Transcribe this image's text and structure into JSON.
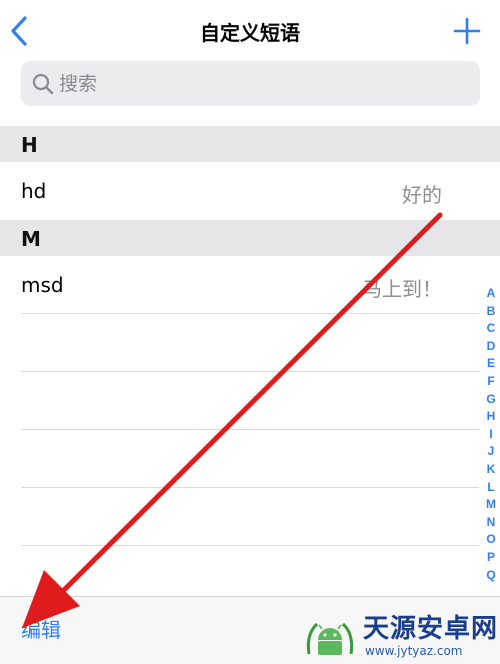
{
  "nav": {
    "title": "自定义短语",
    "back_icon": "chevron-left-icon",
    "add_icon": "plus-icon"
  },
  "search": {
    "placeholder": "搜索",
    "value": ""
  },
  "sections": [
    {
      "header": "H",
      "items": [
        {
          "shortcut": "hd",
          "phrase": "好的"
        }
      ]
    },
    {
      "header": "M",
      "items": [
        {
          "shortcut": "msd",
          "phrase": "马上到！"
        }
      ]
    }
  ],
  "index_letters": [
    "A",
    "B",
    "C",
    "D",
    "E",
    "F",
    "G",
    "H",
    "I",
    "J",
    "K",
    "L",
    "M",
    "N",
    "O",
    "P",
    "Q"
  ],
  "toolbar": {
    "edit_label": "编辑"
  },
  "watermark": {
    "title": "天源安卓网",
    "url": "www.jytyaz.com"
  },
  "colors": {
    "accent": "#2f7ff0",
    "annotation_arrow": "#e01b1b",
    "section_bg": "#e6e6e8",
    "secondary_text": "#8e8e93"
  }
}
